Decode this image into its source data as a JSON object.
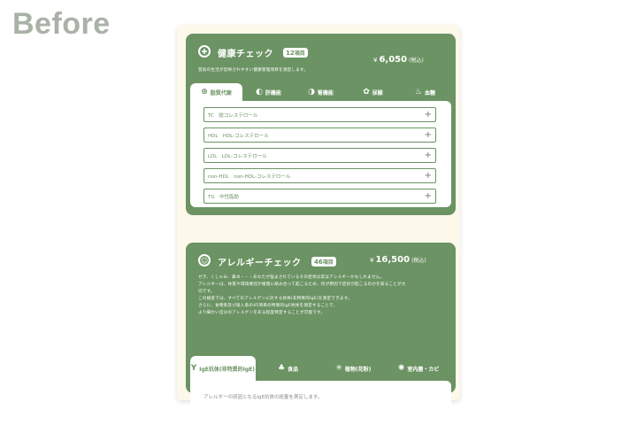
{
  "page": {
    "label": "Before"
  },
  "health": {
    "icon": "health-check-icon",
    "title": "健康チェック",
    "count": "12",
    "count_unit": "項目",
    "price_yen": "¥",
    "price": "6,050",
    "price_tax": "(税込)",
    "description": "普段の生活が反映されやすい健康管理項目を測定します。",
    "tabs": [
      {
        "icon": "lipid-icon",
        "label": "脂質代謝",
        "active": true
      },
      {
        "icon": "liver-icon",
        "label": "肝機能",
        "active": false
      },
      {
        "icon": "kidney-icon",
        "label": "腎機能",
        "active": false
      },
      {
        "icon": "uric-acid-icon",
        "label": "尿酸",
        "active": false
      },
      {
        "icon": "blood-sugar-icon",
        "label": "血糖",
        "active": false
      }
    ],
    "items": [
      {
        "label": "TC　総コレステロール"
      },
      {
        "label": "HDL　HDL-コレステロール"
      },
      {
        "label": "LDL　LDL-コレステロール"
      },
      {
        "label": "non-HDL　non-HDL-コレステロール"
      },
      {
        "label": "TG　中性脂肪"
      }
    ]
  },
  "allergy": {
    "icon": "allergy-face-icon",
    "title": "アレルギーチェック",
    "count": "46",
    "count_unit": "項目",
    "price_yen": "¥",
    "price": "16,500",
    "price_tax": "(税込)",
    "description_lines": [
      "せき、くしゃみ、鼻水・・・あなたが悩まされているその症状は実はアレルギーかもしれません。",
      "アレルギーは、体質や環境要因が複雑に絡み合って起こるため、何が原因で症状が起こるのかを知ることが大",
      "切です。",
      "この検査では、すべてのアレルゲンに対する抗体(非特異的IgE)を測定できます。",
      "さらに、食物系及び吸入系の45項目の特異的IgE抗体を測定することで、",
      "より細かい自分のアレルゲンをある程度特定することが可能です。"
    ],
    "tabs": [
      {
        "icon": "ige-antibody-icon",
        "label": "IgE抗体(非特異的IgE)",
        "active": true
      },
      {
        "icon": "food-icon",
        "label": "食品",
        "active": false
      },
      {
        "icon": "plant-pollen-icon",
        "label": "植物(花粉)",
        "active": false
      },
      {
        "icon": "indoor-mold-icon",
        "label": "室内塵・カビ",
        "active": false
      }
    ],
    "active_content": "アレルギーの原因となるIgE抗体の総量を測定します。"
  }
}
